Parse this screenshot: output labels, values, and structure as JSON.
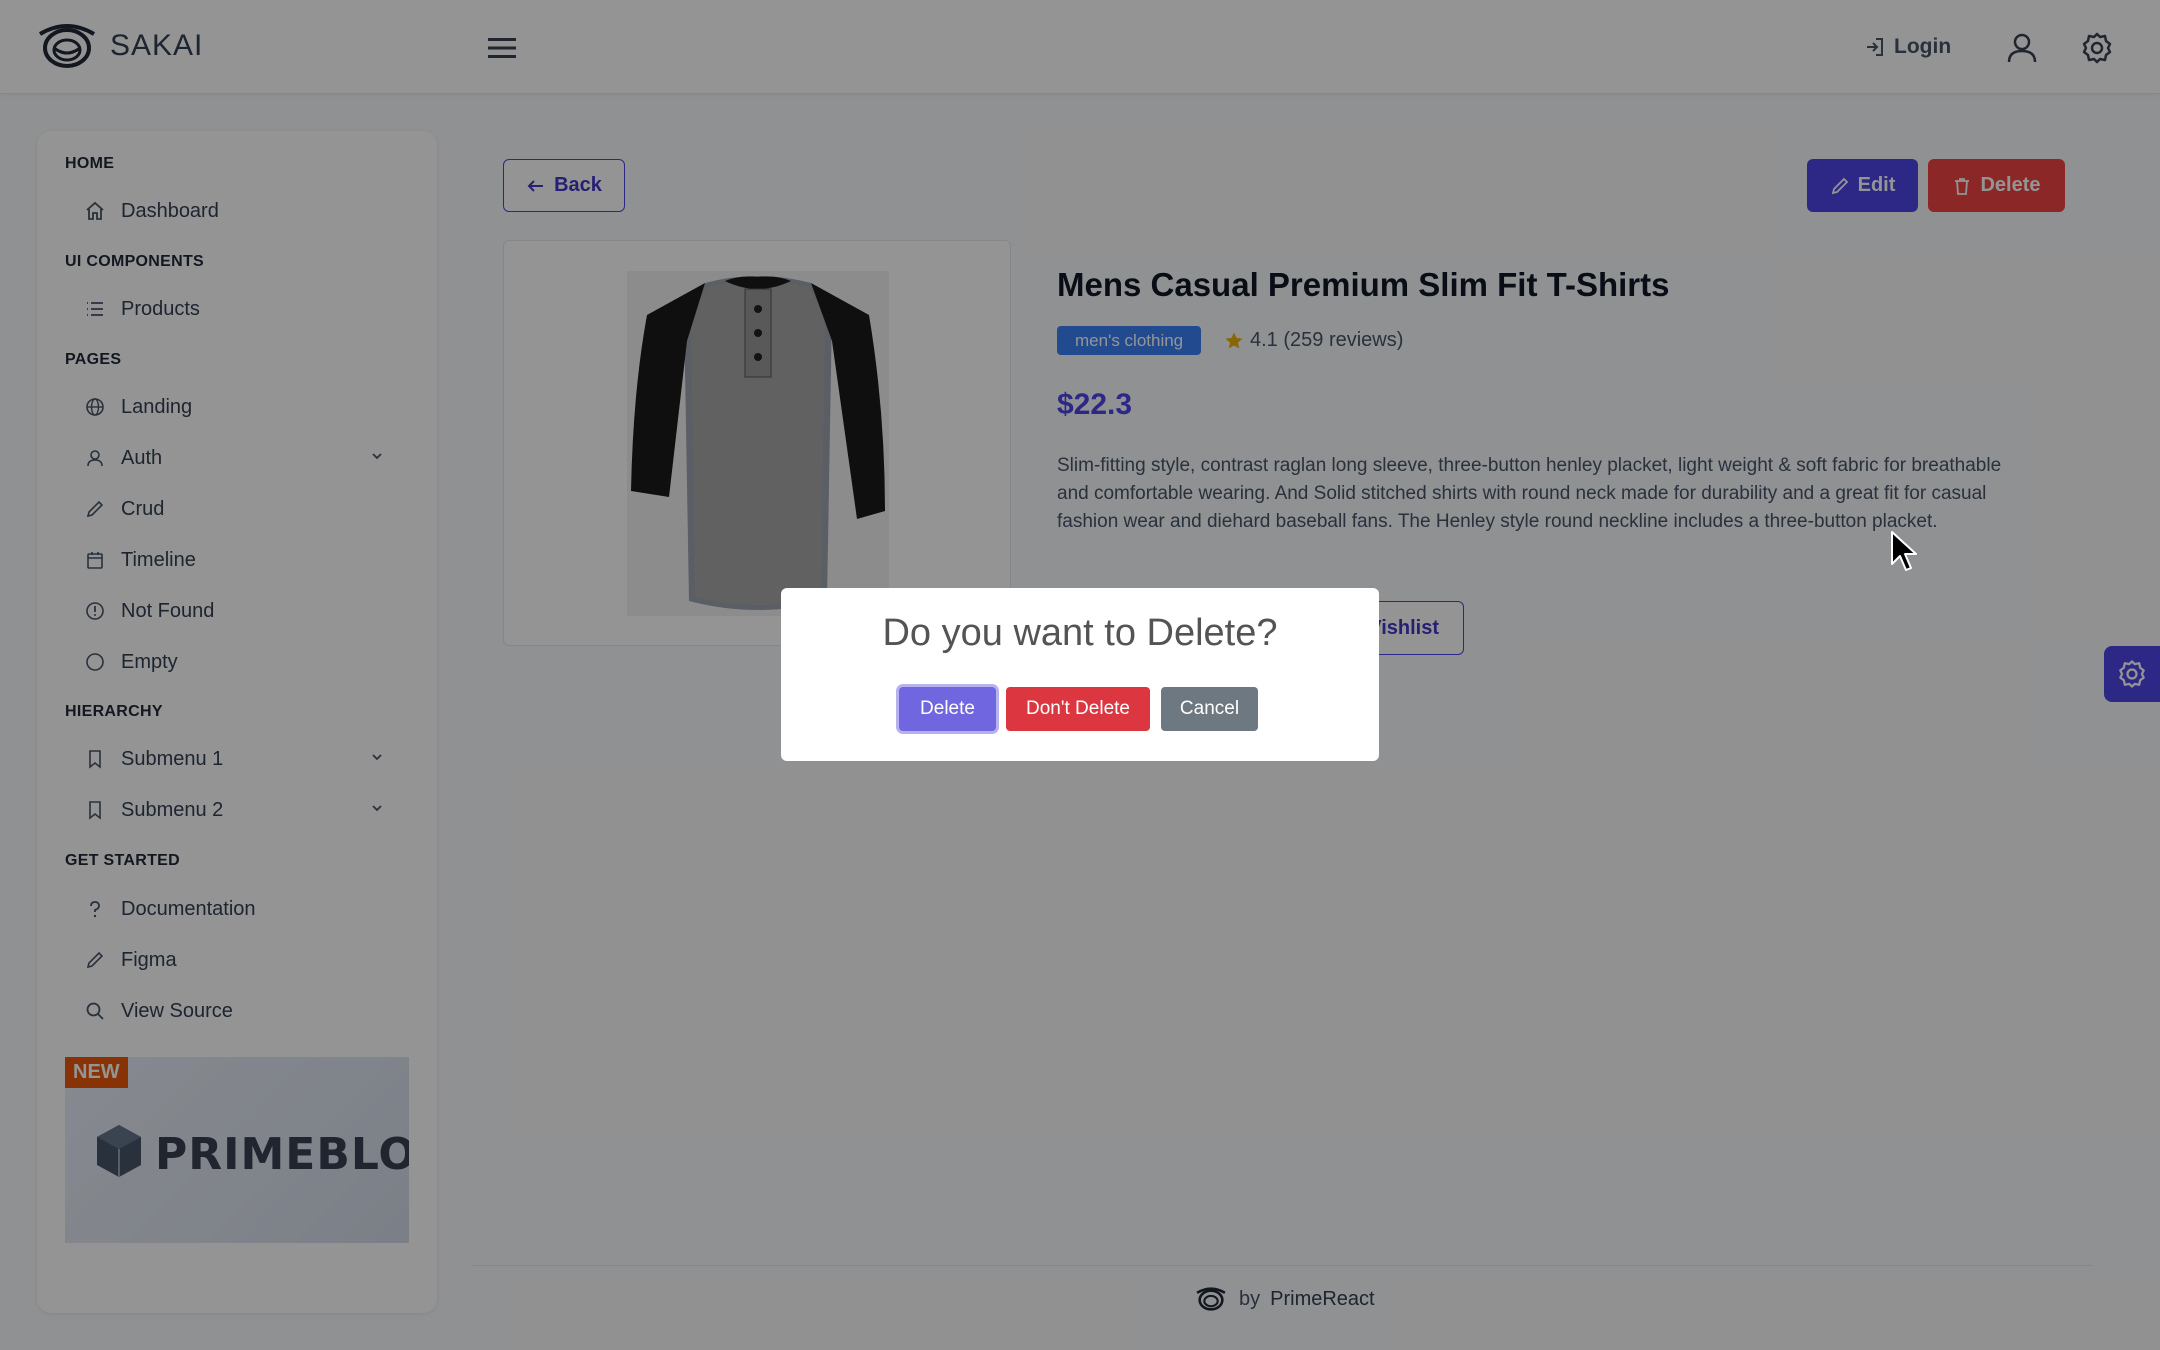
{
  "app": {
    "name": "SAKAI"
  },
  "topbar": {
    "login_label": "Login"
  },
  "sidebar": {
    "sections": [
      {
        "title": "HOME",
        "items": [
          {
            "label": "Dashboard",
            "icon": "home-icon"
          }
        ]
      },
      {
        "title": "UI COMPONENTS",
        "items": [
          {
            "label": "Products",
            "icon": "list-icon"
          }
        ]
      },
      {
        "title": "PAGES",
        "items": [
          {
            "label": "Landing",
            "icon": "globe-icon"
          },
          {
            "label": "Auth",
            "icon": "user-icon",
            "expandable": true
          },
          {
            "label": "Crud",
            "icon": "pencil-icon"
          },
          {
            "label": "Timeline",
            "icon": "calendar-icon"
          },
          {
            "label": "Not Found",
            "icon": "exclamation-circle-icon"
          },
          {
            "label": "Empty",
            "icon": "circle-icon"
          }
        ]
      },
      {
        "title": "HIERARCHY",
        "items": [
          {
            "label": "Submenu 1",
            "icon": "bookmark-icon",
            "expandable": true
          },
          {
            "label": "Submenu 2",
            "icon": "bookmark-icon",
            "expandable": true
          }
        ]
      },
      {
        "title": "GET STARTED",
        "items": [
          {
            "label": "Documentation",
            "icon": "question-icon"
          },
          {
            "label": "Figma",
            "icon": "pencil-icon"
          },
          {
            "label": "View Source",
            "icon": "search-icon"
          }
        ]
      }
    ],
    "promo": {
      "badge": "NEW",
      "title": "PRIMEBLOCKS"
    }
  },
  "content": {
    "back_label": "Back",
    "edit_label": "Edit",
    "delete_label": "Delete",
    "product": {
      "title": "Mens Casual Premium Slim Fit T-Shirts",
      "category": "men's clothing",
      "rating_text": "4.1 (259 reviews)",
      "price": "$22.3",
      "description": "Slim-fitting style, contrast raglan long sleeve, three-button henley placket, light weight & soft fabric for breathable and comfortable wearing. And Solid stitched shirts with round neck made for durability and a great fit for casual fashion wear and diehard baseball fans. The Henley style round neckline includes a three-button placket.",
      "wishlist_label": "Vishlist"
    }
  },
  "footer": {
    "by": "by",
    "brand": "PrimeReact"
  },
  "dialog": {
    "title": "Do you want to Delete?",
    "confirm_label": "Delete",
    "deny_label": "Don't Delete",
    "cancel_label": "Cancel"
  },
  "colors": {
    "primary": "#4f46e5",
    "danger": "#ef4444",
    "tag": "#3b82f6",
    "dialog_confirm": "#7066e0",
    "dialog_deny": "#dc3741",
    "dialog_cancel": "#6e7881",
    "promo_badge": "#ea580c"
  }
}
